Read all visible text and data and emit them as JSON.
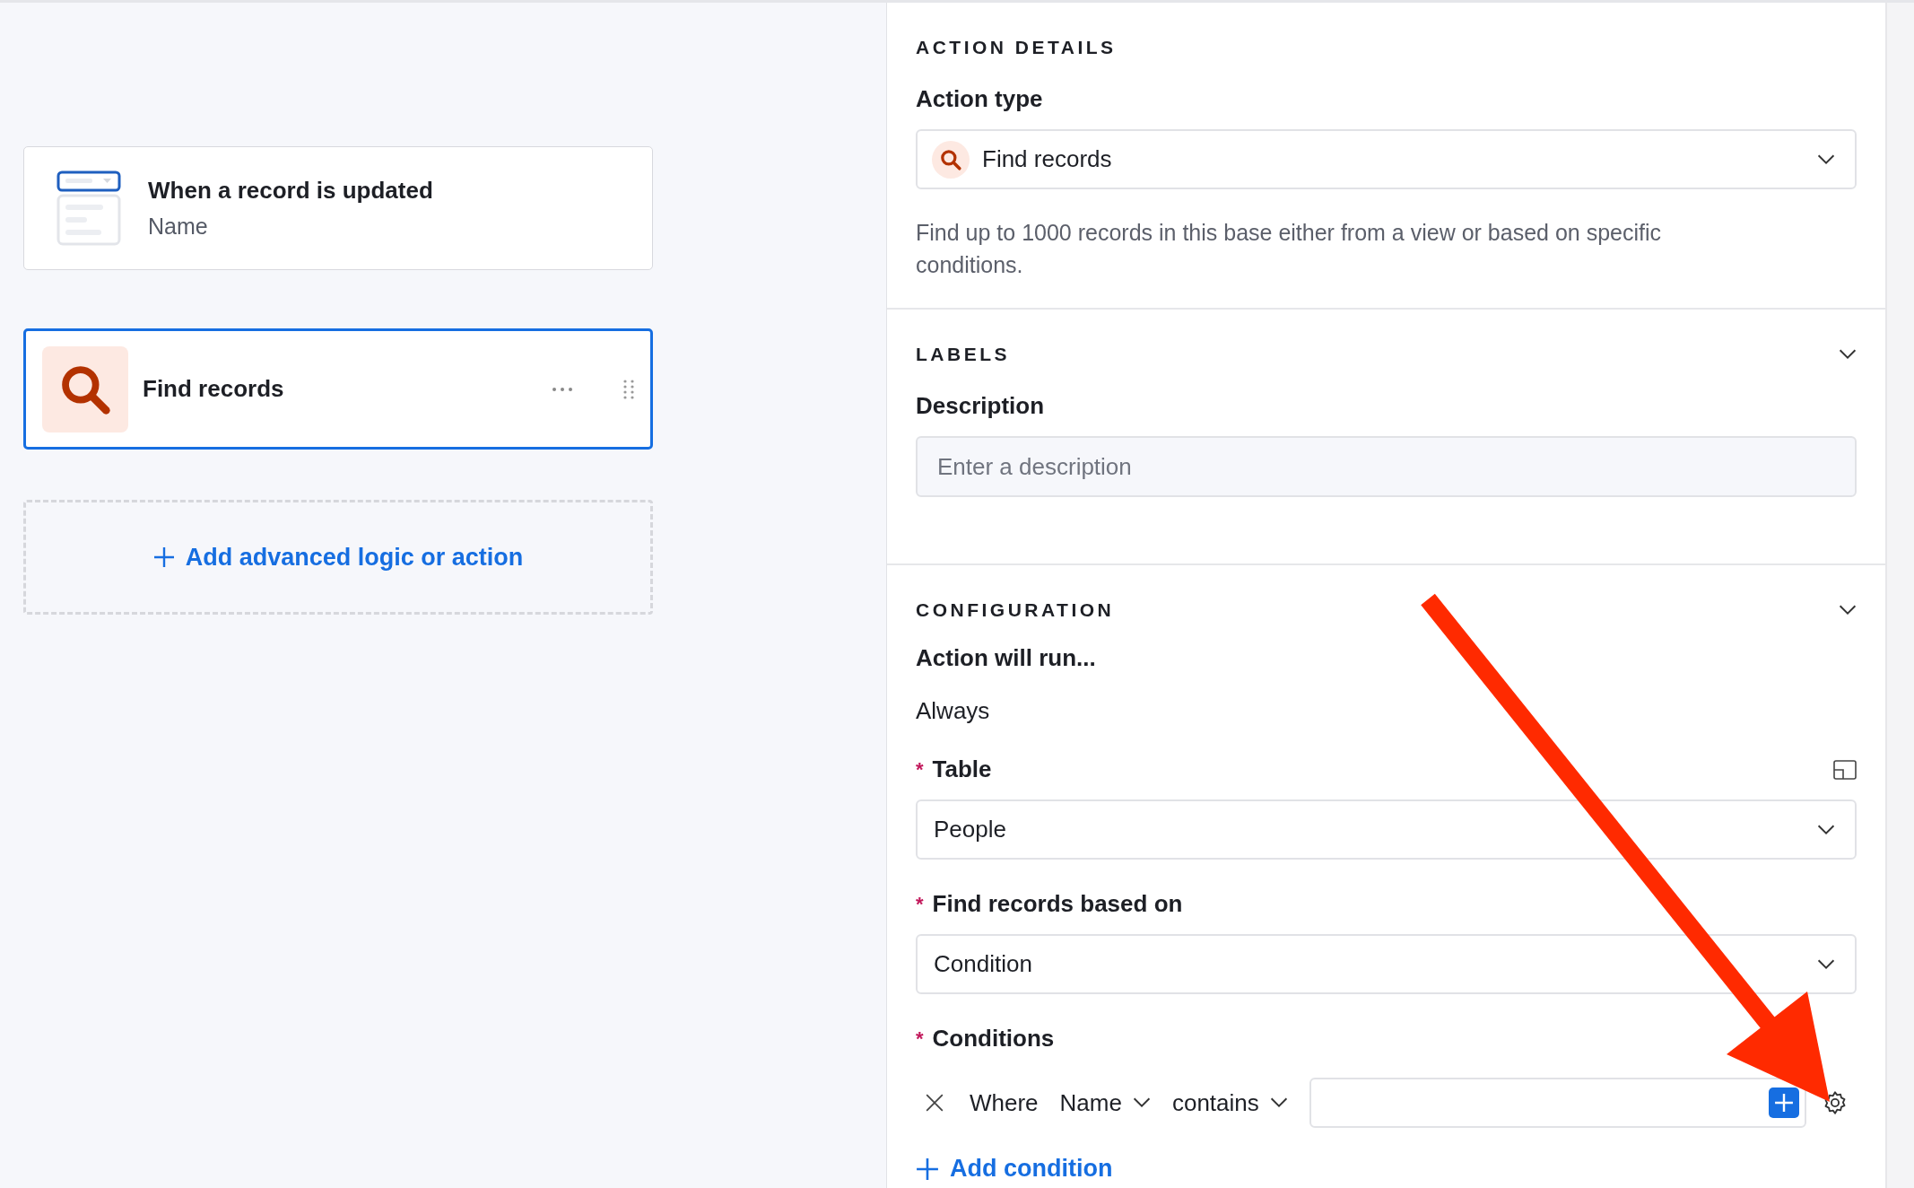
{
  "trigger": {
    "title": "When a record is updated",
    "subtitle": "Name"
  },
  "action_card": {
    "title": "Find records",
    "selected": true
  },
  "add_step": {
    "label": "Add advanced logic or action"
  },
  "action_details": {
    "heading": "ACTION DETAILS",
    "type_label": "Action type",
    "type_value": "Find records",
    "help": "Find up to 1000 records in this base either from a view or based on specific conditions."
  },
  "labels": {
    "heading": "LABELS",
    "description_label": "Description",
    "description_placeholder": "Enter a description"
  },
  "configuration": {
    "heading": "CONFIGURATION",
    "run_label": "Action will run...",
    "run_value": "Always",
    "fields": [
      {
        "marker": "*",
        "label": "Table",
        "value": "People",
        "has_layout_icon": true
      },
      {
        "marker": "*",
        "label": "Find records based on",
        "value": "Condition",
        "has_layout_icon": false
      }
    ],
    "conditions": {
      "marker": "*",
      "label": "Conditions",
      "rows": [
        {
          "prefix": "Where",
          "field": "Name",
          "operator": "contains"
        }
      ],
      "add_label": "Add condition"
    }
  }
}
